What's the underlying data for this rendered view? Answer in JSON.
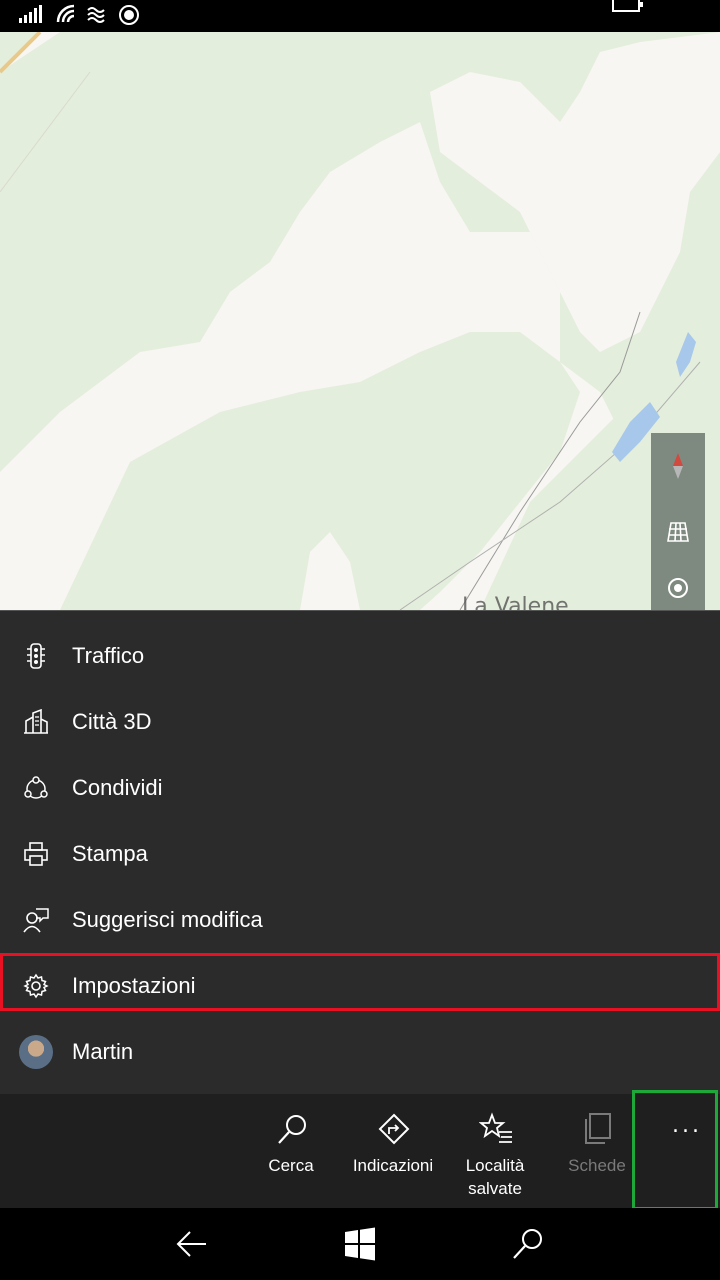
{
  "status_bar": {
    "icons": [
      "signal-icon",
      "wifi-icon",
      "data-icon",
      "location-icon",
      "battery-icon"
    ]
  },
  "map": {
    "place_label": "La Valene"
  },
  "menu": {
    "items": [
      {
        "label": "Traffico",
        "icon": "traffic-icon"
      },
      {
        "label": "Città 3D",
        "icon": "city-3d-icon"
      },
      {
        "label": "Condividi",
        "icon": "share-icon"
      },
      {
        "label": "Stampa",
        "icon": "print-icon"
      },
      {
        "label": "Suggerisci modifica",
        "icon": "suggest-edit-icon"
      },
      {
        "label": "Impostazioni",
        "icon": "gear-icon"
      },
      {
        "label": "Martin",
        "icon": "avatar"
      }
    ]
  },
  "appbar": {
    "search": "Cerca",
    "directions": "Indicazioni",
    "saved_line1": "Località",
    "saved_line2": "salvate",
    "tabs": "Schede",
    "more": "..."
  },
  "colors": {
    "highlight_red": "#e81123",
    "highlight_green": "#1fa83a",
    "menu_bg": "#2b2b2b",
    "appbar_bg": "#1f1f1f",
    "map_green": "#e4eedc",
    "map_light": "#f7f6f2",
    "water": "#a7c8ea"
  }
}
